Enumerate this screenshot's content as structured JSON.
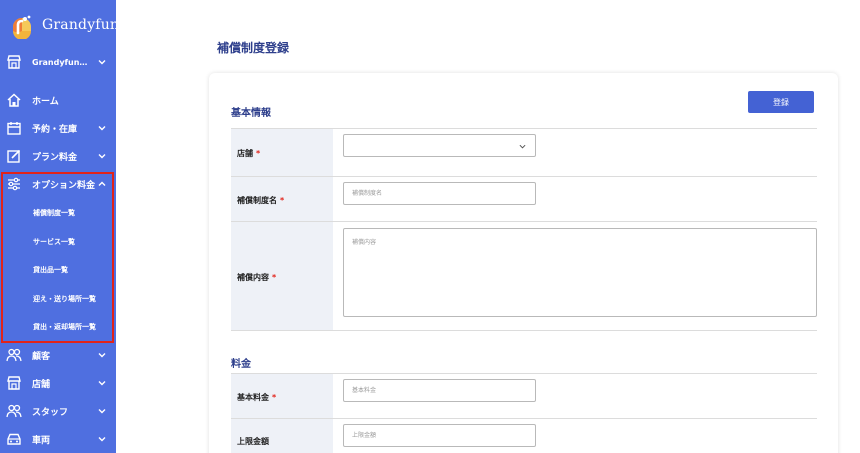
{
  "app": {
    "name": "Grandyfun"
  },
  "sidebar": {
    "store_selector": {
      "label": "Grandyfun…"
    },
    "items": [
      {
        "label": "ホーム"
      },
      {
        "label": "予約・在庫"
      },
      {
        "label": "プラン料金"
      },
      {
        "label": "オプション料金"
      },
      {
        "label": "顧客"
      },
      {
        "label": "店舗"
      },
      {
        "label": "スタッフ"
      },
      {
        "label": "車両"
      }
    ],
    "submenu": [
      {
        "label": "補償制度一覧"
      },
      {
        "label": "サービス一覧"
      },
      {
        "label": "貸出品一覧"
      },
      {
        "label": "迎え・送り場所一覧"
      },
      {
        "label": "貸出・返却場所一覧"
      }
    ]
  },
  "page": {
    "title": "補償制度登録"
  },
  "form": {
    "section_basic": "基本情報",
    "section_price": "料金",
    "submit_label": "登録",
    "required_mark": "*",
    "fields": {
      "store": {
        "label": "店舗",
        "value": ""
      },
      "name": {
        "label": "補償制度名",
        "placeholder": "補償制度名"
      },
      "content": {
        "label": "補償内容",
        "placeholder": "補償内容"
      },
      "base_price": {
        "label": "基本料金",
        "placeholder": "基本料金"
      },
      "max_amount": {
        "label": "上限金額",
        "placeholder": "上限金額"
      }
    }
  },
  "colors": {
    "sidebar_bg": "#4f6fe0",
    "accent": "#4462d4",
    "required": "#e2231a",
    "highlight_border": "#e2231a"
  }
}
